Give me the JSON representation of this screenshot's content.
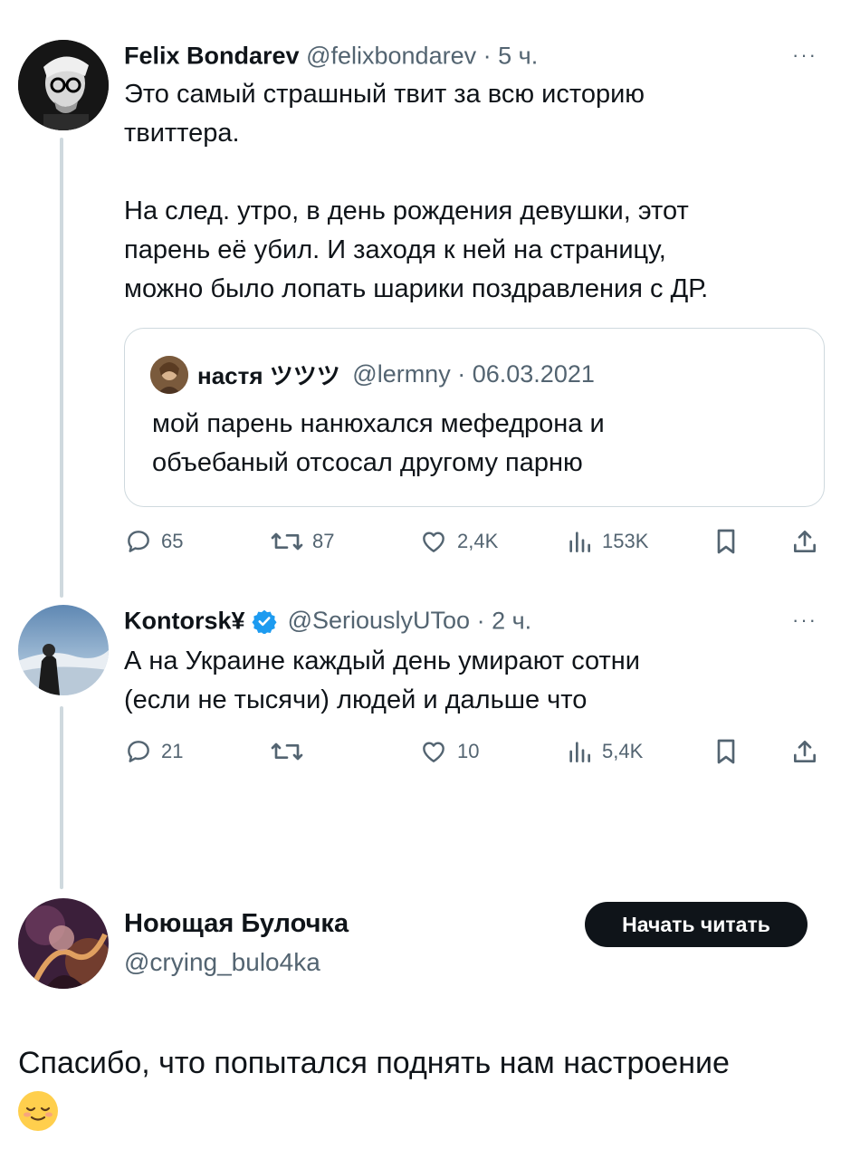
{
  "tweets": [
    {
      "name": "Felix Bondarev",
      "handle": "@felixbondarev",
      "sep": "·",
      "time": "5 ч.",
      "text": "Это самый страшный твит за всю историю\nтвиттера.\n\nНа след. утро, в день рождения девушки, этот\nпарень её убил. И заходя к ней на страницу,\nможно было лопать шарики поздравления с ДР.",
      "quote": {
        "name": "настя ツツツ",
        "handle": "@lermny",
        "sep": "·",
        "date": "06.03.2021",
        "text": "мой парень нанюхался мефедрона и\nобъебаный отсосал другому парню"
      },
      "actions": {
        "replies": "65",
        "retweets": "87",
        "likes": "2,4K",
        "views": "153K"
      }
    },
    {
      "name": "Kontorsk¥",
      "verified": true,
      "handle": "@SeriouslyUToo",
      "sep": "·",
      "time": "2 ч.",
      "text": "А на Украине каждый день умирают сотни\n(если не тысячи) людей и дальше что",
      "actions": {
        "replies": "21",
        "retweets": "",
        "likes": "10",
        "views": "5,4K"
      }
    }
  ],
  "reply_author": {
    "name": "Ноющая Булочка",
    "handle": "@crying_bulo4ka",
    "follow_button": "Начать читать"
  },
  "reply_text": "Спасибо, что попытался поднять нам настроение",
  "more_glyph": "···",
  "colors": {
    "verified": "#1d9bf0",
    "muted": "#536471",
    "text": "#0f1419",
    "line": "#cfd9de"
  },
  "icons": [
    "reply-icon",
    "retweet-icon",
    "like-icon",
    "views-icon",
    "bookmark-icon",
    "share-icon",
    "verified-icon",
    "relieved-face-emoji"
  ]
}
